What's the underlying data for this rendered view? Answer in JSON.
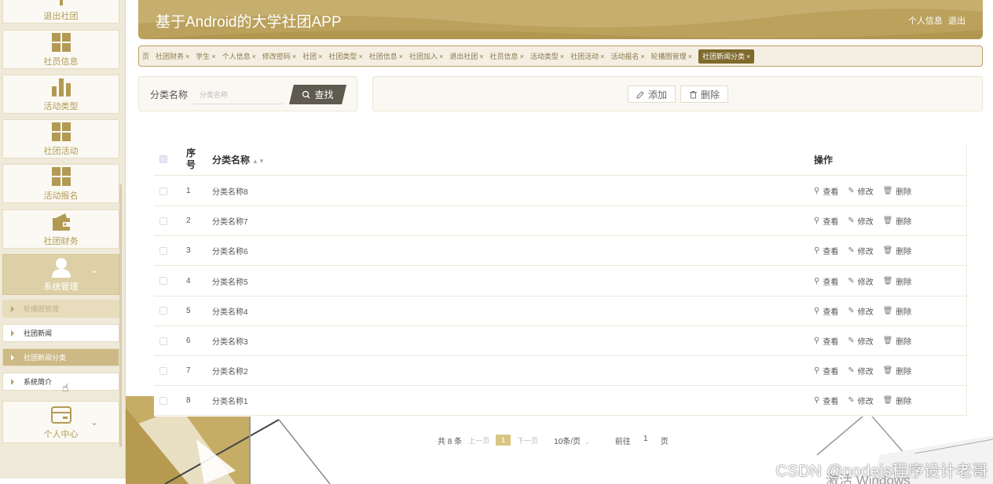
{
  "app": {
    "title": "基于Android的大学社团APP",
    "header_links": [
      "个人信息",
      "退出"
    ]
  },
  "sidebar": {
    "items": [
      {
        "label": "退出社团",
        "icon": "exit-club-icon"
      },
      {
        "label": "社员信息",
        "icon": "grid-icon"
      },
      {
        "label": "活动类型",
        "icon": "bar-chart-icon"
      },
      {
        "label": "社团活动",
        "icon": "grid-icon"
      },
      {
        "label": "活动报名",
        "icon": "grid-icon"
      },
      {
        "label": "社团财务",
        "icon": "wallet-icon"
      },
      {
        "label": "系统管理",
        "icon": "user-icon",
        "expanded": true
      },
      {
        "label": "个人中心",
        "icon": "card-icon"
      }
    ],
    "submenu": [
      {
        "label": "轮播图管理"
      },
      {
        "label": "社团新闻"
      },
      {
        "label": "社团新闻分类",
        "active": true
      },
      {
        "label": "系统简介"
      }
    ]
  },
  "tabs": [
    {
      "label": "页",
      "closable": false
    },
    {
      "label": "社团财务"
    },
    {
      "label": "学生"
    },
    {
      "label": "个人信息"
    },
    {
      "label": "修改密码"
    },
    {
      "label": "社团"
    },
    {
      "label": "社团类型"
    },
    {
      "label": "社团信息"
    },
    {
      "label": "社团加入"
    },
    {
      "label": "退出社团"
    },
    {
      "label": "社员信息"
    },
    {
      "label": "活动类型"
    },
    {
      "label": "社团活动"
    },
    {
      "label": "活动报名"
    },
    {
      "label": "轮播图管理"
    },
    {
      "label": "社团新闻分类",
      "active": true
    }
  ],
  "search": {
    "label": "分类名称",
    "placeholder": "分类名称",
    "button": "查找"
  },
  "actions": {
    "add": "添加",
    "delete": "删除"
  },
  "table": {
    "headers": {
      "index": "序号",
      "name": "分类名称",
      "ops": "操作"
    },
    "op_labels": {
      "view": "查看",
      "edit": "修改",
      "delete": "删除"
    },
    "rows": [
      {
        "index": "1",
        "name": "分类名称8"
      },
      {
        "index": "2",
        "name": "分类名称7"
      },
      {
        "index": "3",
        "name": "分类名称6"
      },
      {
        "index": "4",
        "name": "分类名称5"
      },
      {
        "index": "5",
        "name": "分类名称4"
      },
      {
        "index": "6",
        "name": "分类名称3"
      },
      {
        "index": "7",
        "name": "分类名称2"
      },
      {
        "index": "8",
        "name": "分类名称1"
      }
    ]
  },
  "pagination": {
    "total": "共 8 条",
    "prev": "上一页",
    "current": "1",
    "next": "下一页",
    "page_size": "10条/页",
    "goto_label": "前往",
    "goto_value": "1",
    "page_unit": "页"
  },
  "overlay": {
    "watermark": "CSDN @nodejs程序设计老哥",
    "os_text": "激活 Windows"
  },
  "colors": {
    "brand": "#bba15c",
    "active_tab": "#7f6a2c",
    "sidebar_bg": "#efe9d9"
  }
}
